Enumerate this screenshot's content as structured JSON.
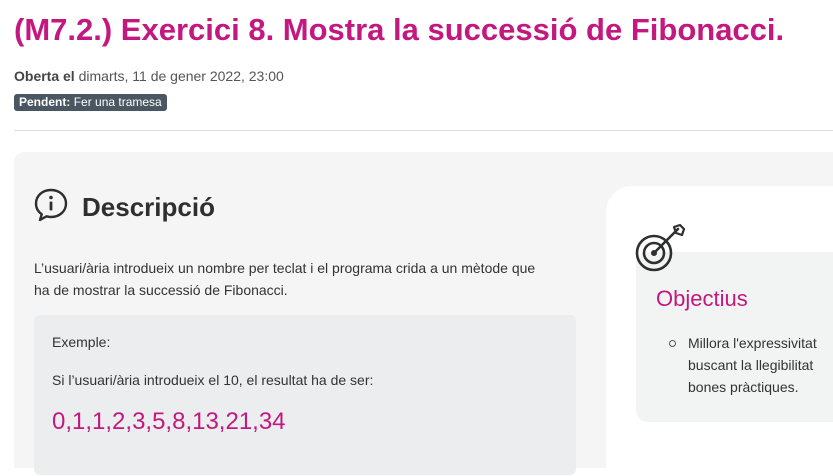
{
  "assignment": {
    "title": "(M7.2.) Exercici 8. Mostra la successió de Fibonacci.",
    "opened_label": "Oberta el",
    "opened_date": "dimarts, 11 de gener 2022, 23:00",
    "status_label": "Pendent:",
    "status_value": "Fer una tramesa"
  },
  "description": {
    "icon": "info-speech-bubble-icon",
    "heading": "Descripció",
    "text": "L’usuari/ària introdueix un nombre per teclat i el programa crida a un mètode que ha de mostrar la successió de Fibonacci.",
    "example_label": "Exemple:",
    "example_text": "Si l’usuari/ària introdueix el 10, el resultat ha de ser:",
    "example_result": "0,1,1,2,3,5,8,13,21,34"
  },
  "objectives": {
    "icon": "target-arrow-icon",
    "heading": "Objectius",
    "items": [
      {
        "lines": [
          "Millora l'expressivitat",
          "buscant la llegibilitat",
          "bones pràctiques."
        ]
      }
    ]
  },
  "colors": {
    "accent": "#c3187f",
    "badge_bg": "#4a5661",
    "panel_bg": "#f5f5f5",
    "example_bg": "#ebedee"
  }
}
